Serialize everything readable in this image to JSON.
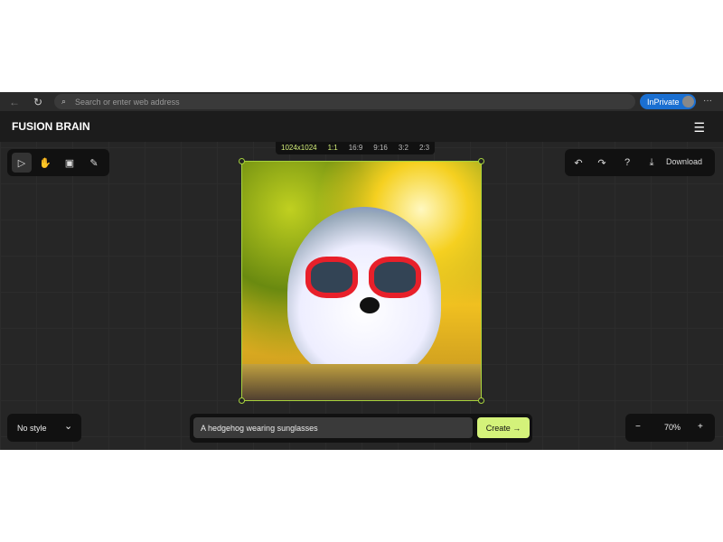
{
  "browser": {
    "search_placeholder": "Search or enter web address",
    "inprivate": "InPrivate",
    "back": "←",
    "refresh": "↻",
    "more": "···"
  },
  "app": {
    "title": "FUSION BRAIN",
    "menu": "☰"
  },
  "toolbar": {
    "tools": [
      {
        "icon": "pointer-icon",
        "glyph": "▷"
      },
      {
        "icon": "hand-icon",
        "glyph": "✋"
      },
      {
        "icon": "image-add-icon",
        "glyph": "▣"
      },
      {
        "icon": "eraser-icon",
        "glyph": "✎"
      }
    ]
  },
  "ratios": {
    "size": "1024x1024",
    "options": [
      "1:1",
      "16:9",
      "9:16",
      "3:2",
      "2:3"
    ],
    "selected": "1:1"
  },
  "actions": {
    "undo": "↶",
    "redo": "↷",
    "help": "?",
    "download_icon": "⤓",
    "download": "Download"
  },
  "style": {
    "value": "No style",
    "chevron": "⌄"
  },
  "prompt": {
    "value": "A hedgehog wearing sunglasses",
    "create": "Create",
    "arrow": "→"
  },
  "zoom": {
    "minus": "−",
    "value": "70%",
    "plus": "+"
  }
}
